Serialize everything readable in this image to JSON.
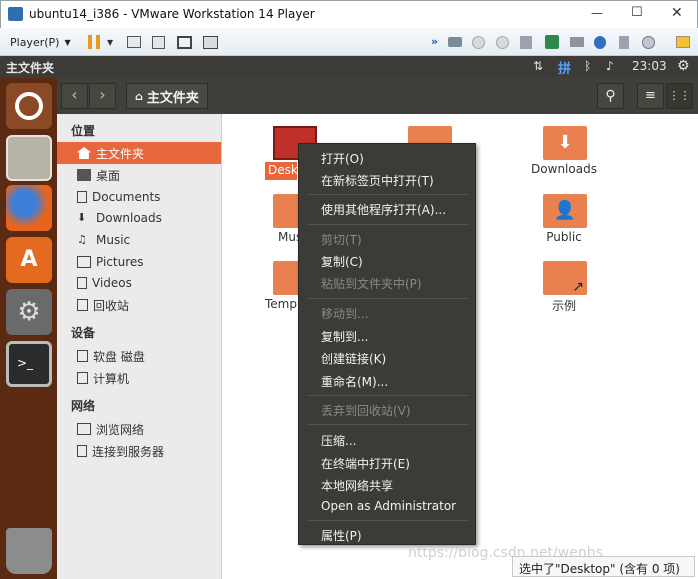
{
  "window": {
    "title": "ubuntu14_i386 - VMware Workstation 14 Player",
    "minimize": "—",
    "maximize": "☐",
    "close": "✕"
  },
  "vm_toolbar": {
    "player_menu": "Player(P)"
  },
  "ubuntu_bar": {
    "app_title": "主文件夹",
    "time": "23:03"
  },
  "nav": {
    "location": "主文件夹"
  },
  "sidebar": {
    "sections": [
      {
        "title": "位置",
        "items": [
          "主文件夹",
          "桌面",
          "Documents",
          "Downloads",
          "Music",
          "Pictures",
          "Videos",
          "回收站"
        ]
      },
      {
        "title": "设备",
        "items": [
          "软盘 磁盘",
          "计算机"
        ]
      },
      {
        "title": "网络",
        "items": [
          "浏览网络",
          "连接到服务器"
        ]
      }
    ]
  },
  "files": [
    "Desk",
    "Downloads",
    "Mus",
    "Public",
    "Temp",
    "示例"
  ],
  "context_menu": [
    {
      "label": "打开(O)",
      "enabled": true
    },
    {
      "label": "在新标签页中打开(T)",
      "enabled": true
    },
    {
      "label": "使用其他程序打开(A)...",
      "enabled": true
    },
    {
      "label": "剪切(T)",
      "enabled": false
    },
    {
      "label": "复制(C)",
      "enabled": true
    },
    {
      "label": "粘贴到文件夹中(P)",
      "enabled": false
    },
    {
      "label": "移动到...",
      "enabled": false
    },
    {
      "label": "复制到...",
      "enabled": true
    },
    {
      "label": "创建链接(K)",
      "enabled": true
    },
    {
      "label": "重命名(M)...",
      "enabled": true
    },
    {
      "label": "丢弃到回收站(V)",
      "enabled": false
    },
    {
      "label": "压缩...",
      "enabled": true
    },
    {
      "label": "在终端中打开(E)",
      "enabled": true
    },
    {
      "label": "本地网络共享",
      "enabled": true
    },
    {
      "label": "Open as Administrator",
      "enabled": true
    },
    {
      "label": "属性(P)",
      "enabled": true
    }
  ],
  "status": "选中了\"Desktop\" (含有 0 项)",
  "watermark": "https://blog.csdn.net/wenhs",
  "colors": {
    "accent": "#e8673d",
    "panel": "#3c3b37",
    "launcher": "#5a2a12"
  }
}
